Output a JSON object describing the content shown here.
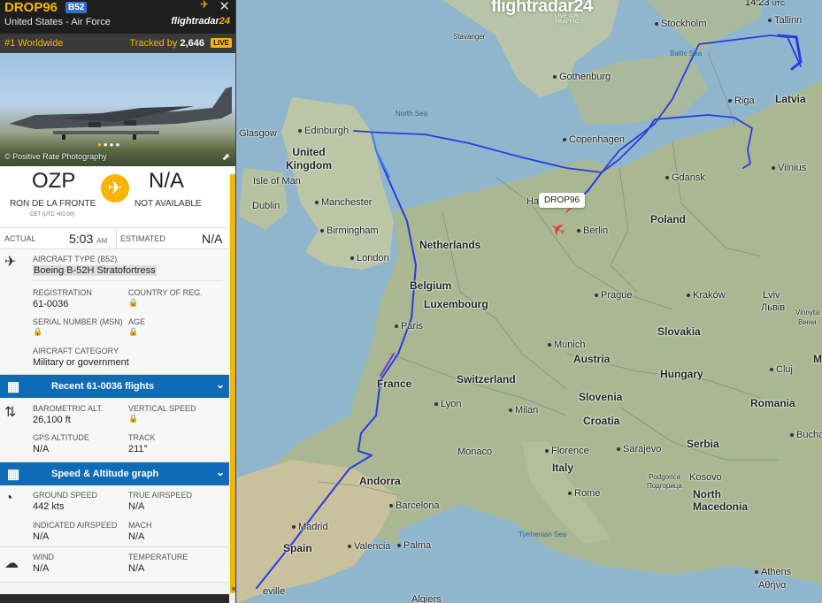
{
  "map_header": {
    "logo": "flightradar24",
    "logo_sub": "LIVE AIR TRAFFIC",
    "time": "14:23",
    "time_zone": "UTC"
  },
  "map": {
    "tag": "DROP96",
    "labels": {
      "stavanger": "Stavanger",
      "stockholm": "Stockholm",
      "tallinn": "Tallinn",
      "baltic_sea": "Baltic Sea",
      "gothenburg": "Gothenburg",
      "riga": "Riga",
      "latvia": "Latvia",
      "north_sea": "North Sea",
      "glasgow": "Glasgow",
      "edinburgh": "Edinburgh",
      "copenhagen": "Copenhagen",
      "uk": "United\nKingdom",
      "isle_of_man": "Isle of Man",
      "gdansk": "Gdansk",
      "vilnius": "Vilnius",
      "dublin": "Dublin",
      "manchester": "Manchester",
      "hamburg": "Ha",
      "poland": "Poland",
      "berlin": "Berlin",
      "birmingham": "Birmingham",
      "netherlands": "Netherlands",
      "london": "London",
      "belgium": "Belgium",
      "prague": "Prague",
      "krakow": "Kraków",
      "lviv": "Lviv",
      "lviv_local": "Львів",
      "luxembourg": "Luxembourg",
      "vinnytsia": "Vinnytsi",
      "vinnytsia_local": "Вінни",
      "paris": "Paris",
      "slovakia": "Slovakia",
      "munich": "Munich",
      "austria": "Austria",
      "hungary": "Hungary",
      "france": "France",
      "switzerland": "Switzerland",
      "slovenia": "Slovenia",
      "lyon": "Lyon",
      "milan": "Milan",
      "croatia": "Croatia",
      "romania": "Romania",
      "cluj": "Cluj",
      "bucharest": "Bucha",
      "serbia": "Serbia",
      "monaco": "Monaco",
      "florence": "Florence",
      "sarajevo": "Sarajevo",
      "italy": "Italy",
      "andorra": "Andorra",
      "podgorica": "Podgorica",
      "podgorica_local": "Подгорица",
      "kosovo": "Kosovo",
      "rome": "Rome",
      "north_macedonia": "North\nMacedonia",
      "barcelona": "Barcelona",
      "madrid": "Madrid",
      "tyrrhenian_sea": "Tyrrhenian Sea",
      "spain": "Spain",
      "valencia": "Valencia",
      "palma": "Palma",
      "athens": "Athens",
      "athens_local": "Αθήνα",
      "seville": "eville",
      "algiers": "Algiers",
      "me": "Me"
    }
  },
  "panel": {
    "callsign": "DROP96",
    "type_code": "B52",
    "operator": "United States - Air Force",
    "brand": "flightradar",
    "brand_num": "24",
    "rank": "#1 Worldwide",
    "tracked_label": "Tracked by",
    "tracked_count": "2,646",
    "live": "LIVE",
    "photo_credit": "© Positive Rate Photography",
    "origin_code": "OZP",
    "origin_name": "RON DE LA FRONTE",
    "origin_tz": "CET (UTC +01:00)",
    "dest_code": "N/A",
    "dest_name": "NOT AVAILABLE",
    "actual_label": "ACTUAL",
    "actual_time": "5:03",
    "actual_ampm": "AM",
    "estimated_label": "ESTIMATED",
    "estimated_time": "N/A",
    "aircraft_type_label": "AIRCRAFT TYPE",
    "aircraft_type_code": "(B52)",
    "aircraft_type": "Boeing B-52H Stratofortress",
    "registration_label": "REGISTRATION",
    "registration": "61-0036",
    "country_label": "COUNTRY OF REG.",
    "serial_label": "SERIAL NUMBER (MSN)",
    "age_label": "AGE",
    "category_label": "AIRCRAFT CATEGORY",
    "category": "Military or government",
    "recent_flights": "Recent 61-0036 flights",
    "baro_alt_label": "BAROMETRIC ALT.",
    "baro_alt": "26,100 ft",
    "vspeed_label": "VERTICAL SPEED",
    "gps_alt_label": "GPS ALTITUDE",
    "gps_alt": "N/A",
    "track_label": "TRACK",
    "track": "211°",
    "speed_graph": "Speed & Altitude graph",
    "ground_speed_label": "GROUND SPEED",
    "ground_speed": "442 kts",
    "true_airspeed_label": "TRUE AIRSPEED",
    "true_airspeed": "N/A",
    "ias_label": "INDICATED AIRSPEED",
    "ias": "N/A",
    "mach_label": "MACH",
    "mach": "N/A",
    "wind_label": "WIND",
    "wind": "N/A",
    "temp_label": "TEMPERATURE",
    "temp": "N/A"
  },
  "colors": {
    "accent": "#f7b500",
    "route": "#2b3be0",
    "bar": "#0f6bb5"
  },
  "icons": [
    "close-icon",
    "bookmark-icon",
    "plane-icon",
    "lock-icon",
    "chevron-down-icon",
    "calendar-icon",
    "graph-icon",
    "altitude-icon",
    "speedometer-icon",
    "weather-icon",
    "expand-icon"
  ]
}
